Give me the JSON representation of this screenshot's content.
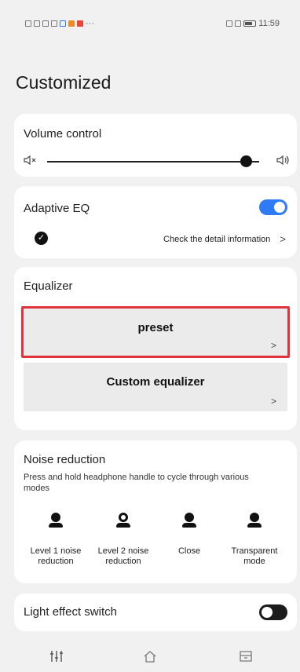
{
  "status": {
    "time": "11:59"
  },
  "page": {
    "title": "Customized"
  },
  "volume": {
    "label": "Volume control",
    "level": 0.94,
    "mute_icon": "speaker-mute-icon",
    "loud_icon": "speaker-loud-icon"
  },
  "adaptive_eq": {
    "label": "Adaptive EQ",
    "enabled": true,
    "detail_label": "Check the detail information",
    "check_icon": "check-circle-icon"
  },
  "equalizer": {
    "label": "Equalizer",
    "options": [
      {
        "label": "preset",
        "highlighted": true
      },
      {
        "label": "Custom equalizer",
        "highlighted": false
      }
    ]
  },
  "noise_reduction": {
    "label": "Noise reduction",
    "description": "Press and hold headphone handle to cycle through various modes",
    "modes": [
      {
        "label": "Level 1 noise reduction",
        "icon": "person-icon"
      },
      {
        "label": "Level 2 noise reduction",
        "icon": "person-ring-icon"
      },
      {
        "label": "Close",
        "icon": "person-icon"
      },
      {
        "label": "Transparent mode",
        "icon": "person-transparent-icon"
      }
    ]
  },
  "light_effect": {
    "label": "Light effect switch",
    "enabled": false
  },
  "nav": {
    "items": [
      "equalizer-sliders-icon",
      "home-icon",
      "store-icon"
    ]
  },
  "colors": {
    "accent": "#2f7bf5",
    "highlight_border": "#e0333b",
    "background": "#f1f1f1",
    "card": "#ffffff"
  }
}
